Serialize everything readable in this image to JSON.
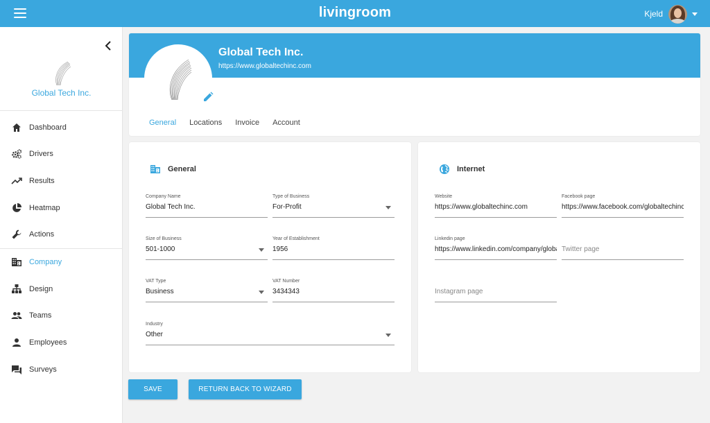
{
  "app": {
    "brand": "livingroom"
  },
  "user": {
    "name": "Kjeld"
  },
  "sidebar": {
    "company_name": "Global Tech Inc.",
    "items": [
      {
        "label": "Dashboard",
        "icon": "home-icon"
      },
      {
        "label": "Drivers",
        "icon": "gears-icon"
      },
      {
        "label": "Results",
        "icon": "trending-up-icon"
      },
      {
        "label": "Heatmap",
        "icon": "pie-chart-icon"
      },
      {
        "label": "Actions",
        "icon": "wrench-icon"
      },
      {
        "label": "Company",
        "icon": "building-icon",
        "active": true
      },
      {
        "label": "Design",
        "icon": "sitemap-icon"
      },
      {
        "label": "Teams",
        "icon": "people-icon"
      },
      {
        "label": "Employees",
        "icon": "person-icon"
      },
      {
        "label": "Surveys",
        "icon": "chat-icon"
      }
    ]
  },
  "header": {
    "title": "Global Tech Inc.",
    "url": "https://www.globaltechinc.com",
    "tabs": [
      {
        "label": "General",
        "active": true
      },
      {
        "label": "Locations"
      },
      {
        "label": "Invoice"
      },
      {
        "label": "Account"
      }
    ]
  },
  "general": {
    "title": "General",
    "company_name": {
      "label": "Company Name",
      "value": "Global Tech Inc."
    },
    "type_of_business": {
      "label": "Type of Business",
      "value": "For-Profit"
    },
    "size_of_business": {
      "label": "Size of Business",
      "value": "501-1000"
    },
    "year_of_establishment": {
      "label": "Year of Establishment",
      "value": "1956"
    },
    "vat_type": {
      "label": "VAT Type",
      "value": "Business"
    },
    "vat_number": {
      "label": "VAT Number",
      "value": "3434343"
    },
    "industry": {
      "label": "Industry",
      "value": "Other"
    }
  },
  "internet": {
    "title": "Internet",
    "website": {
      "label": "Website",
      "value": "https://www.globaltechinc.com"
    },
    "facebook": {
      "label": "Facebook page",
      "value": "https://www.facebook.com/globaltechinc"
    },
    "linkedin": {
      "label": "Linkedin page",
      "value": "https://www.linkedin.com/company/globaltechinc"
    },
    "twitter": {
      "placeholder": "Twitter page"
    },
    "instagram": {
      "placeholder": "Instagram page"
    }
  },
  "actions": {
    "save": "SAVE",
    "return": "RETURN BACK TO WIZARD"
  },
  "colors": {
    "accent": "#3aa7de",
    "text": "#333333"
  }
}
